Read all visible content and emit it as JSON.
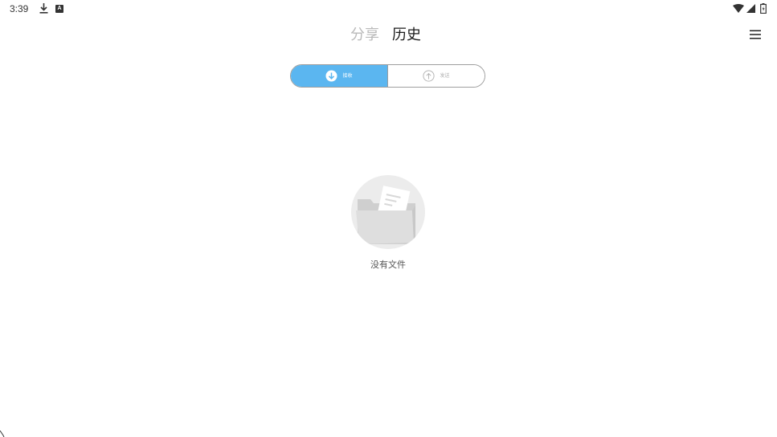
{
  "status_bar": {
    "time": "3:39",
    "notification_letter": "A"
  },
  "header": {
    "tabs": [
      {
        "label": "分享",
        "active": false
      },
      {
        "label": "历史",
        "active": true
      }
    ]
  },
  "segmented": {
    "receive_label": "接收",
    "send_label": "发送",
    "selected": "receive"
  },
  "empty_state": {
    "message": "没有文件"
  },
  "colors": {
    "accent": "#5bb6f0",
    "inactive_tab": "#b9b9b9",
    "active_tab": "#1a1a1a"
  }
}
